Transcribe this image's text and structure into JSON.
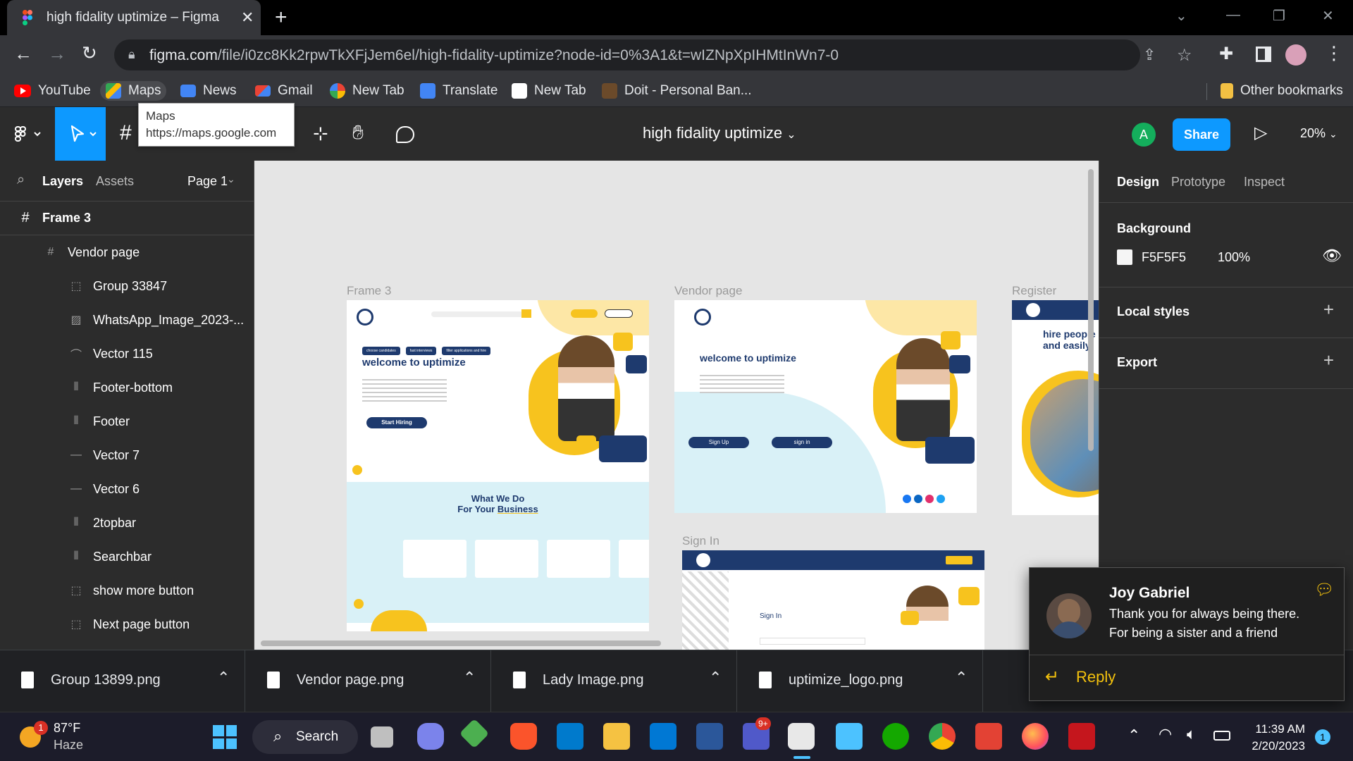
{
  "browser": {
    "tab_title": "high fidality uptimize – Figma",
    "url_host": "figma.com",
    "url_path": "/file/i0zc8Kk2rpwTkXFjJem6el/high-fidality-uptimize?node-id=0%3A1&t=wIZNpXpIHMtInWn7-0",
    "bookmarks": [
      "YouTube",
      "Maps",
      "News",
      "Gmail",
      "New Tab",
      "Translate",
      "New Tab",
      "Doit - Personal Ban..."
    ],
    "other_bookmarks": "Other bookmarks",
    "tooltip_title": "Maps",
    "tooltip_url": "https://maps.google.com"
  },
  "figma": {
    "file_title": "high fidality uptimize",
    "share_label": "Share",
    "zoom": "20%",
    "avatar_initial": "A",
    "left_tabs": {
      "layers": "Layers",
      "assets": "Assets",
      "page": "Page 1"
    },
    "layers": [
      {
        "name": "Frame 3",
        "icon": "frame-icon"
      },
      {
        "name": "Vendor page",
        "icon": "frame-icon"
      },
      {
        "name": "Group 33847",
        "icon": "group-icon"
      },
      {
        "name": "WhatsApp_Image_2023-...",
        "icon": "image-icon"
      },
      {
        "name": "Vector 115",
        "icon": "vector-icon"
      },
      {
        "name": "Footer-bottom",
        "icon": "autolayout-icon"
      },
      {
        "name": "Footer",
        "icon": "autolayout-icon"
      },
      {
        "name": "Vector 7",
        "icon": "line-icon"
      },
      {
        "name": "Vector 6",
        "icon": "line-icon"
      },
      {
        "name": "2topbar",
        "icon": "autolayout-icon"
      },
      {
        "name": "Searchbar",
        "icon": "autolayout-icon"
      },
      {
        "name": "show more button",
        "icon": "group-icon"
      },
      {
        "name": "Next page button",
        "icon": "group-icon"
      }
    ],
    "right_tabs": {
      "design": "Design",
      "prototype": "Prototype",
      "inspect": "Inspect"
    },
    "background_label": "Background",
    "background_hex": "F5F5F5",
    "background_opacity": "100%",
    "local_styles": "Local styles",
    "export": "Export",
    "canvas": {
      "frame3_label": "Frame 3",
      "vendor_label": "Vendor page",
      "register_label": "Register",
      "signin_label": "Sign In",
      "welcome": "welcome to uptimize",
      "start_hiring": "Start Hiring",
      "sign_up": "Sign Up",
      "sign_in": "sign in",
      "what_we_do_1": "What We Do",
      "what_we_do_2": "For Your",
      "what_we_do_3": "Business",
      "hire_people": "hire people",
      "and_easily": "and easily",
      "signin_heading": "Sign In",
      "chip_1": "choose candidates",
      "chip_2": "fast interviews",
      "chip_3": "filter applications and hire"
    }
  },
  "downloads": [
    "Group 13899.png",
    "Vendor page.png",
    "Lady Image.png",
    "uptimize_logo.png"
  ],
  "notification": {
    "name": "Joy Gabriel",
    "message": "Thank you for always being there. For being a sister and a friend",
    "reply": "Reply"
  },
  "taskbar": {
    "temperature": "87°F",
    "condition": "Haze",
    "weather_badge": "1",
    "search": "Search",
    "teams_badge": "9+",
    "time": "11:39 AM",
    "date": "2/20/2023",
    "notif_count": "1"
  }
}
